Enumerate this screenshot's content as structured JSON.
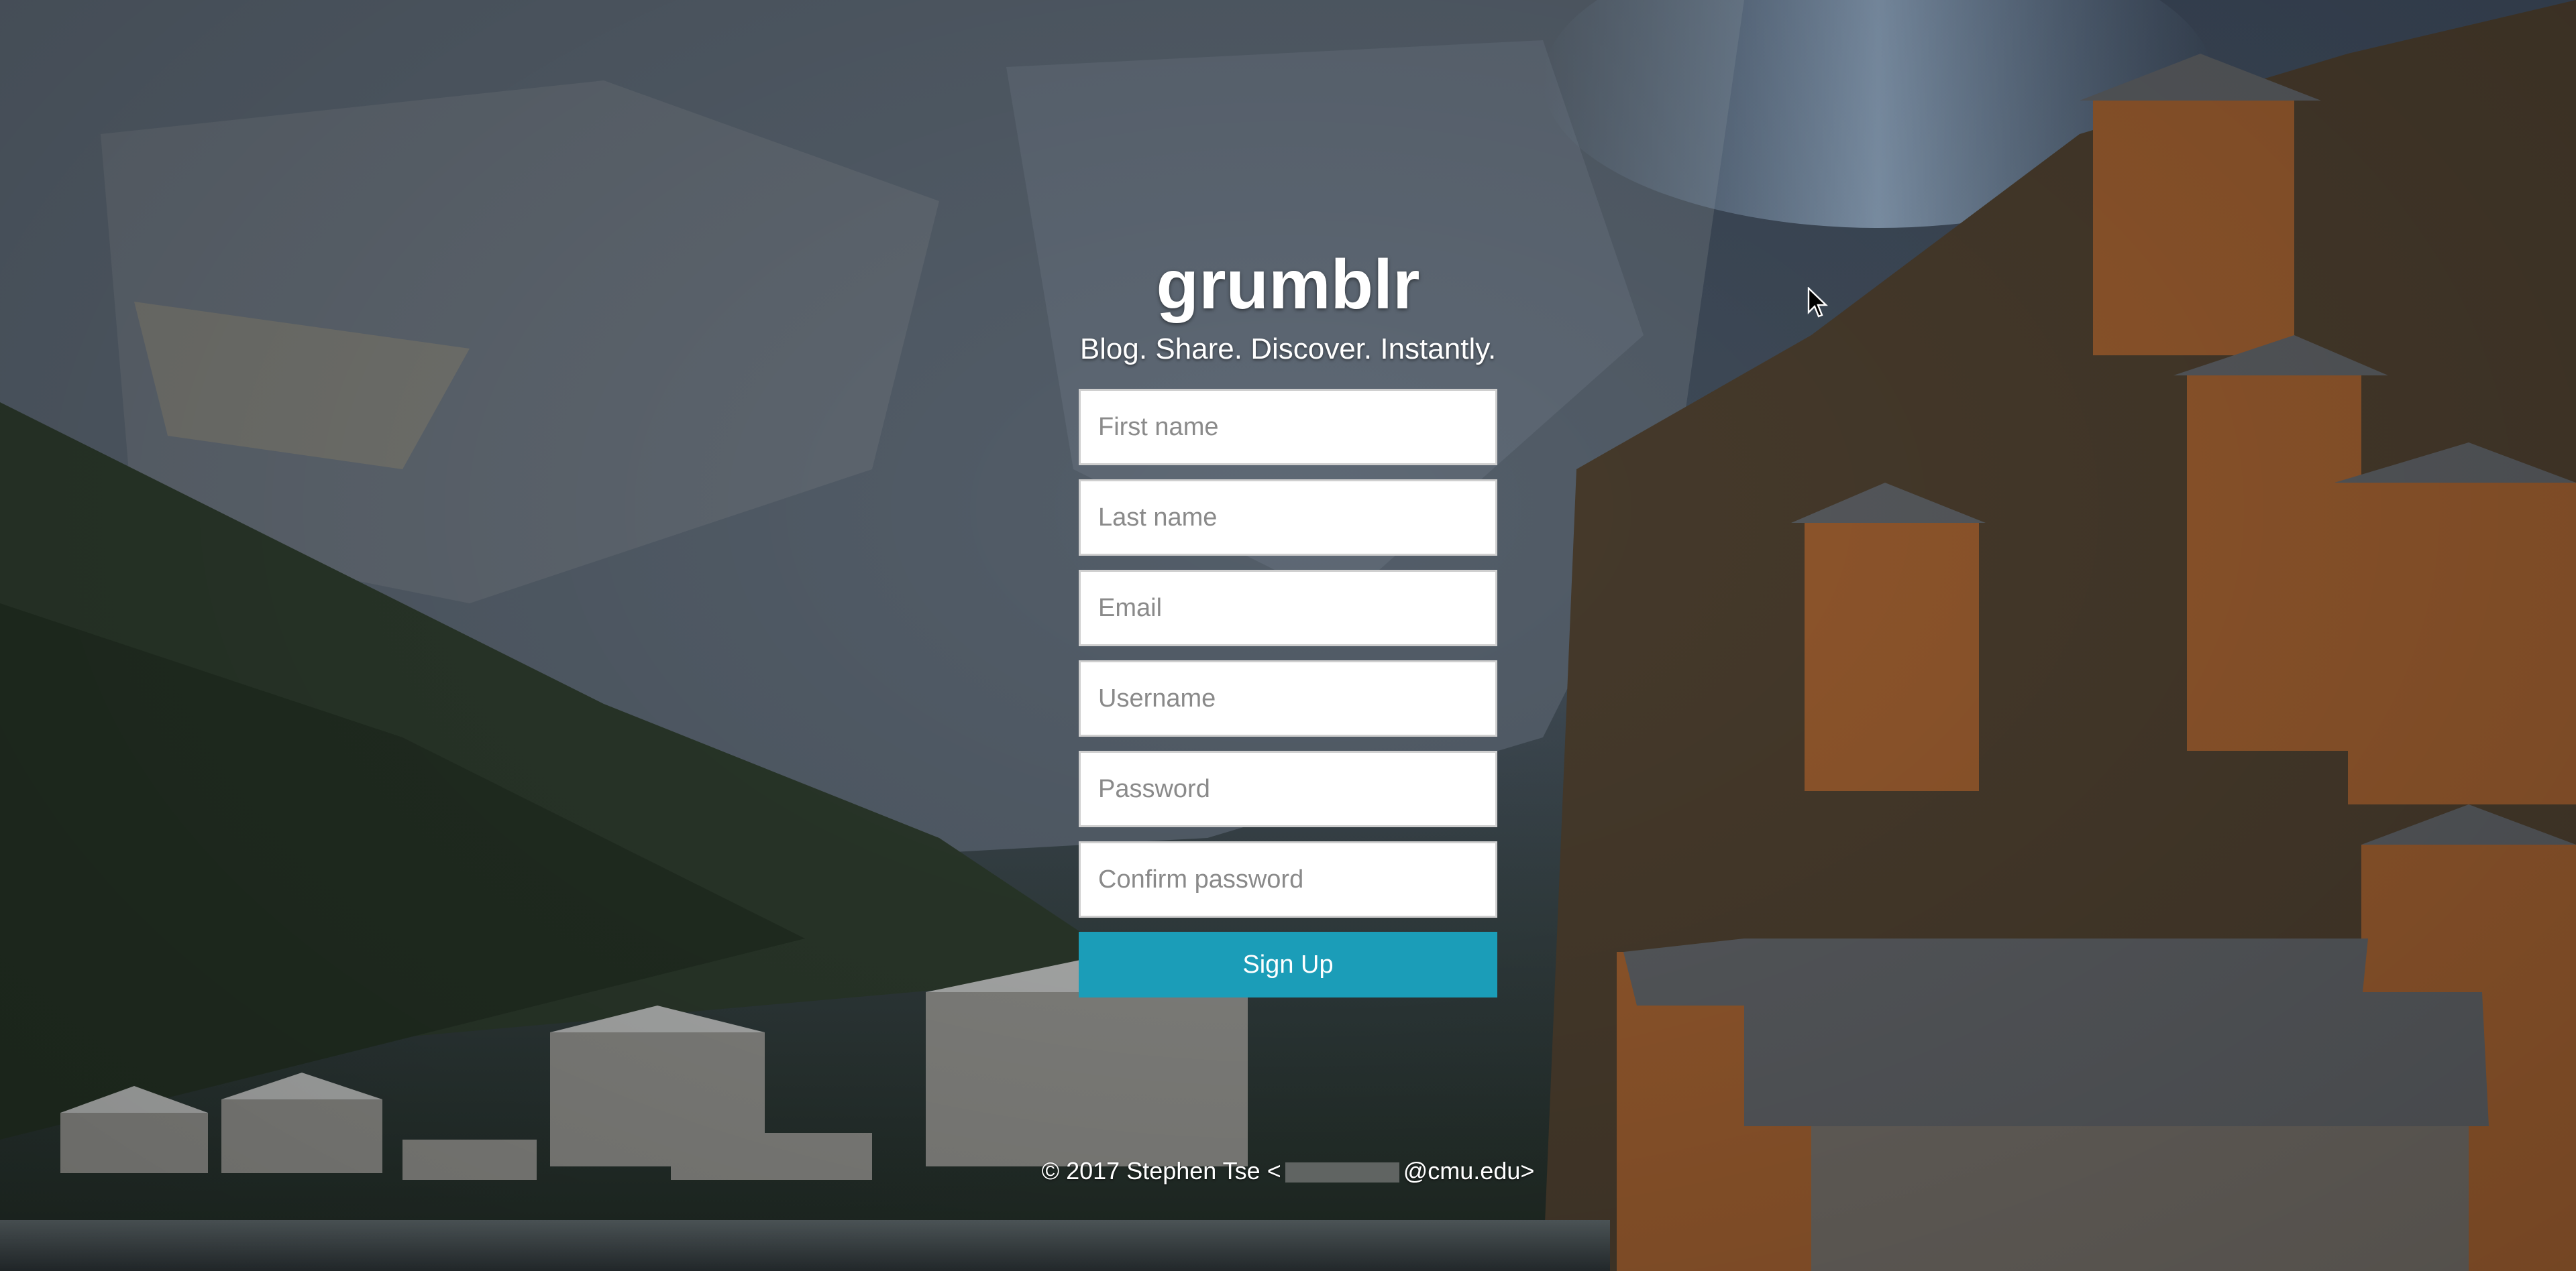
{
  "brand": {
    "title": "grumblr",
    "tagline": "Blog. Share. Discover. Instantly."
  },
  "form": {
    "first_name_placeholder": "First name",
    "last_name_placeholder": "Last name",
    "email_placeholder": "Email",
    "username_placeholder": "Username",
    "password_placeholder": "Password",
    "confirm_password_placeholder": "Confirm password",
    "submit_label": "Sign Up"
  },
  "footer": {
    "copyright_prefix": "© 2017 Stephen Tse <",
    "email_suffix": "@cmu.edu>"
  },
  "colors": {
    "accent": "#1b9db8",
    "text_on_background": "#ffffff"
  },
  "icons": {
    "cursor": "mouse-pointer-icon",
    "background": "mountain-village-photo"
  }
}
